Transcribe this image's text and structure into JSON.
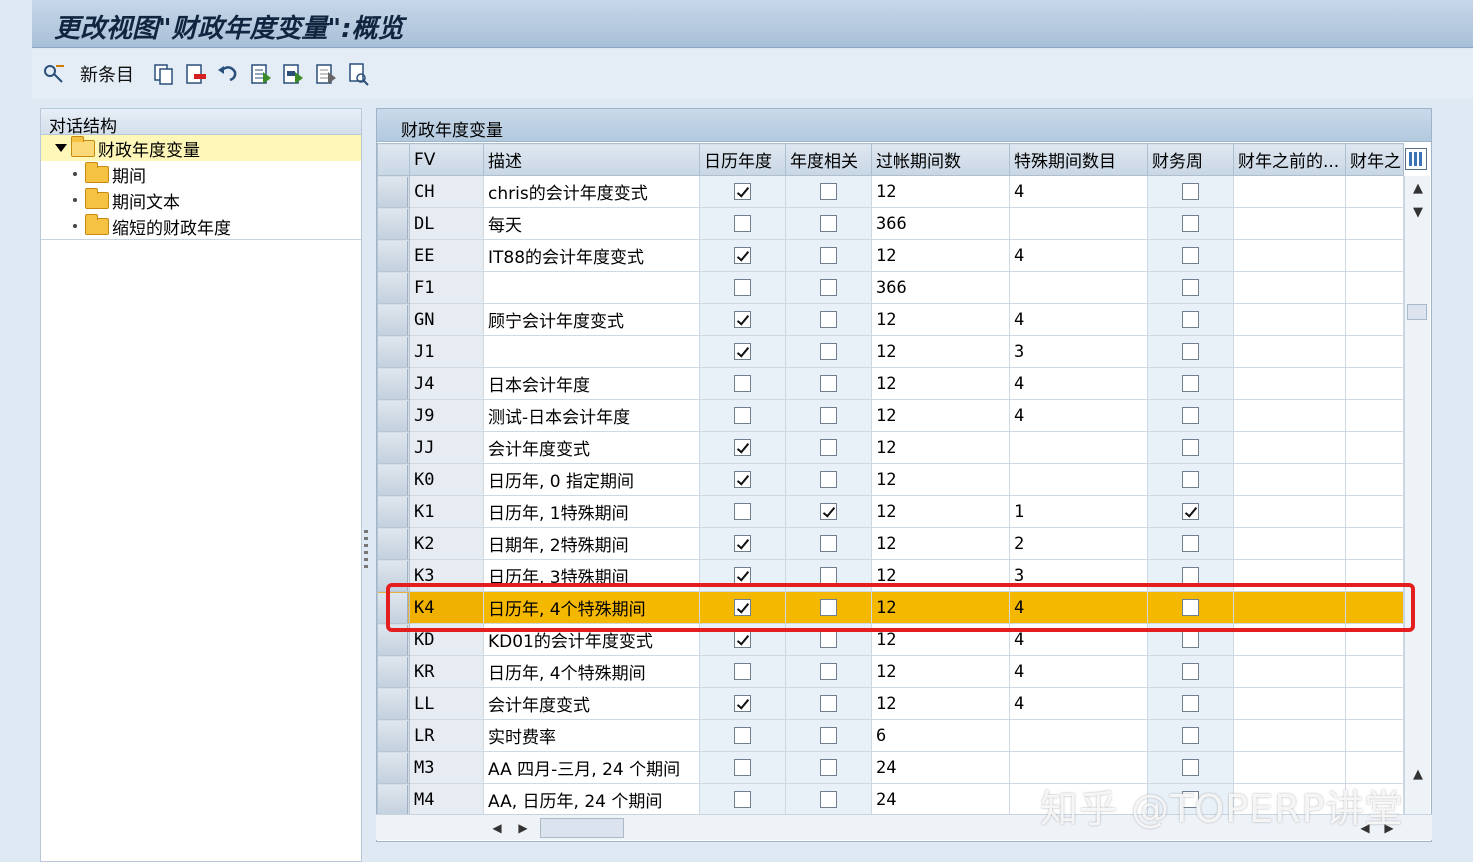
{
  "window": {
    "title": "更改视图\"财政年度变量\":概览"
  },
  "toolbar": {
    "new_entries_label": "新条目",
    "icons": [
      "display-change-icon",
      "copy-icon",
      "delete-icon",
      "undo-icon",
      "select-all-icon",
      "select-block-icon",
      "deselect-all-icon",
      "print-icon"
    ]
  },
  "dialog_structure": {
    "title": "对话结构",
    "items": [
      {
        "label": "财政年度变量",
        "selected": true,
        "level": 0
      },
      {
        "label": "期间",
        "level": 1
      },
      {
        "label": "期间文本",
        "level": 1
      },
      {
        "label": "缩短的财政年度",
        "level": 1
      }
    ]
  },
  "table": {
    "title": "财政年度变量",
    "columns": [
      "FV",
      "描述",
      "日历年度",
      "年度相关",
      "过帐期间数",
      "特殊期间数目",
      "财务周",
      "财年之前的...",
      "财年之"
    ],
    "rows": [
      {
        "fv": "CH",
        "desc": "chris的会计年度变式",
        "cal": true,
        "yr": false,
        "periods": "12",
        "special": "4",
        "week": false
      },
      {
        "fv": "DL",
        "desc": "每天",
        "cal": false,
        "yr": false,
        "periods": "366",
        "special": "",
        "week": false
      },
      {
        "fv": "EE",
        "desc": "IT88的会计年度变式",
        "cal": true,
        "yr": false,
        "periods": "12",
        "special": "4",
        "week": false
      },
      {
        "fv": "F1",
        "desc": "",
        "cal": false,
        "yr": false,
        "periods": "366",
        "special": "",
        "week": false
      },
      {
        "fv": "GN",
        "desc": "顾宁会计年度变式",
        "cal": true,
        "yr": false,
        "periods": "12",
        "special": "4",
        "week": false
      },
      {
        "fv": "J1",
        "desc": "",
        "cal": true,
        "yr": false,
        "periods": "12",
        "special": "3",
        "week": false
      },
      {
        "fv": "J4",
        "desc": "日本会计年度",
        "cal": false,
        "yr": false,
        "periods": "12",
        "special": "4",
        "week": false
      },
      {
        "fv": "J9",
        "desc": "测试-日本会计年度",
        "cal": false,
        "yr": false,
        "periods": "12",
        "special": "4",
        "week": false
      },
      {
        "fv": "JJ",
        "desc": "会计年度变式",
        "cal": true,
        "yr": false,
        "periods": "12",
        "special": "",
        "week": false
      },
      {
        "fv": "K0",
        "desc": "日历年, 0 指定期间",
        "cal": true,
        "yr": false,
        "periods": "12",
        "special": "",
        "week": false
      },
      {
        "fv": "K1",
        "desc": "日历年, 1特殊期间",
        "cal": false,
        "yr": true,
        "periods": "12",
        "special": "1",
        "week": true
      },
      {
        "fv": "K2",
        "desc": "日期年, 2特殊期间",
        "cal": true,
        "yr": false,
        "periods": "12",
        "special": "2",
        "week": false
      },
      {
        "fv": "K3",
        "desc": "日历年, 3特殊期间",
        "cal": true,
        "yr": false,
        "periods": "12",
        "special": "3",
        "week": false
      },
      {
        "fv": "K4",
        "desc": "日历年, 4个特殊期间",
        "cal": true,
        "yr": false,
        "periods": "12",
        "special": "4",
        "week": false,
        "highlighted": true
      },
      {
        "fv": "KD",
        "desc": "KD01的会计年度变式",
        "cal": true,
        "yr": false,
        "periods": "12",
        "special": "4",
        "week": false
      },
      {
        "fv": "KR",
        "desc": "日历年, 4个特殊期间",
        "cal": false,
        "yr": false,
        "periods": "12",
        "special": "4",
        "week": false
      },
      {
        "fv": "LL",
        "desc": "会计年度变式",
        "cal": true,
        "yr": false,
        "periods": "12",
        "special": "4",
        "week": false
      },
      {
        "fv": "LR",
        "desc": "实时费率",
        "cal": false,
        "yr": false,
        "periods": "6",
        "special": "",
        "week": false
      },
      {
        "fv": "M3",
        "desc": "AA 四月-三月, 24 个期间",
        "cal": false,
        "yr": false,
        "periods": "24",
        "special": "",
        "week": false
      },
      {
        "fv": "M4",
        "desc": "AA, 日历年, 24 个期间",
        "cal": false,
        "yr": false,
        "periods": "24",
        "special": "",
        "week": false
      }
    ]
  },
  "watermark": "知乎 @TOPERP讲堂",
  "colors": {
    "highlight_row": "#f5b800",
    "highlight_border": "#e41e1e"
  }
}
